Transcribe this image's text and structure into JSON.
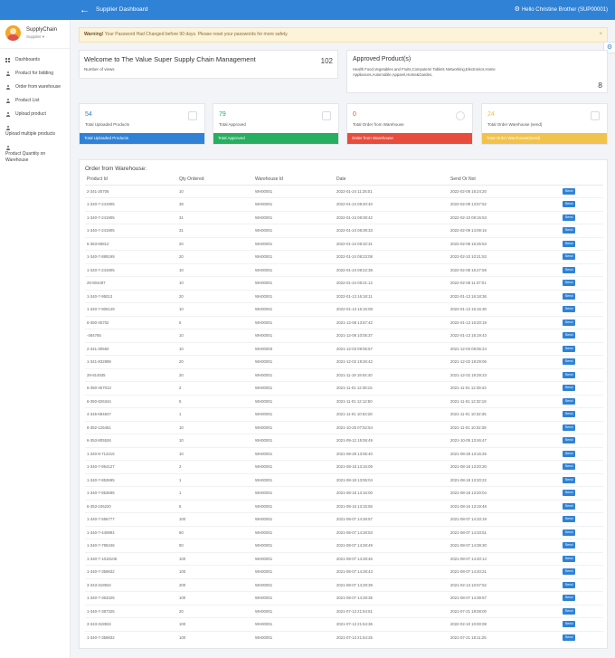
{
  "topbar": {
    "title": "Supplier Dashboard",
    "back_icon": "arrow-left-icon",
    "greeting": "Hello Christine Brother (SUP00001)"
  },
  "sidebar": {
    "brand_name": "SupplyChain",
    "role": "Supplier ▾",
    "items": [
      {
        "label": "Dashboards",
        "icon": "grid-icon"
      },
      {
        "label": "Product for bidding",
        "icon": "user-icon"
      },
      {
        "label": "Order from warehouse",
        "icon": "user-icon"
      },
      {
        "label": "Product List",
        "icon": "user-icon"
      },
      {
        "label": "Upload product",
        "icon": "user-icon"
      },
      {
        "label": "Upload multiple products",
        "icon": "user-icon"
      },
      {
        "label": "Product Quantity on Warehouse",
        "icon": "user-icon"
      }
    ]
  },
  "alert": {
    "strong": "Warning!",
    "text": " Your Password Had Changed before 90 days. Please reset your passwords for more safety.",
    "close": "×"
  },
  "welcome": {
    "title": "Welcome to The Value Super Supply Chain Management",
    "count": "102",
    "sub": "Number of views"
  },
  "approved": {
    "title": "Approved Product(s)",
    "list": "Health Food,Vegetables and Fruits,Computers/ Tablets Networking,Electronics,Home Appliances,Automobile,Apparel,Home&Garden,",
    "count": "8"
  },
  "stats": [
    {
      "value": "54",
      "label": "Total Uploaded Products",
      "footer": "Total Uploaded Products",
      "color": "#2f82d6"
    },
    {
      "value": "79",
      "label": "Total Approved",
      "footer": "Total Approved",
      "color": "#27ae60"
    },
    {
      "value": "0",
      "label": "Total Order from Warehouse",
      "footer": "Order from Warehouse",
      "color": "#e74c3c"
    },
    {
      "value": "24",
      "label": "Total Order Warehouse (send)",
      "footer": "Total Order Warehouse(send)",
      "color": "#f1c24c"
    }
  ],
  "orders": {
    "title": "Order from Warehouse:",
    "columns": [
      "Product Id",
      "Qty Ordered",
      "Warehouse Id",
      "Date",
      "Send Or Not"
    ],
    "send_label": "Send",
    "rows": [
      [
        "2-341-25706",
        "10",
        "WH00001",
        "2022-01-24 11:25:01",
        "2022-02-08 16:24:20"
      ],
      [
        "1-340-7-241905",
        "39",
        "WH00001",
        "2022-01-24 08:40:40",
        "2022-02-09 13:57:52"
      ],
      [
        "1-340-7-241905",
        "31",
        "WH00001",
        "2022-01-24 08:39:42",
        "2022-02-10 09:15:53"
      ],
      [
        "1-340-7-241905",
        "31",
        "WH00001",
        "2022-01-24 08:39:33",
        "2022-02-09 14:09:16"
      ],
      [
        "6-353-69812",
        "20",
        "WH00001",
        "2022-01-24 08:32:31",
        "2022-02-08 16:25:53"
      ],
      [
        "1-340-7-889199",
        "20",
        "WH00001",
        "2022-01-24 08:23:08",
        "2022-02-10 10:21:53"
      ],
      [
        "1-340-7-241905",
        "10",
        "WH00001",
        "2022-01-24 08:22:38",
        "2022-02-08 16:27:59"
      ],
      [
        "29-804497",
        "10",
        "WH00001",
        "2022-01-24 08:21:12",
        "2022-02-08 11:37:01"
      ],
      [
        "1-340-7-95013",
        "20",
        "WH00001",
        "2022-01-13 16:18:11",
        "2022-01-13 16:18:36"
      ],
      [
        "1-340-7-906149",
        "10",
        "WH00001",
        "2022-01-13 16:16:08",
        "2022-01-13 16:16:30"
      ],
      [
        "6-350-45702",
        "5",
        "WH00001",
        "2021-12-08 13:57:42",
        "2022-01-13 16:20:19"
      ],
      [
        "-484765",
        "10",
        "WH00001",
        "2021-12-08 10:05:37",
        "2022-01-13 16:19:43"
      ],
      [
        "2-341-30550",
        "10",
        "WH00003",
        "2021-12-03 09:05:57",
        "2021-12-03 09:06:24"
      ],
      [
        "1-341-832899",
        "20",
        "WH00001",
        "2021-12-02 19:26:42",
        "2021-12-02 19:29:06"
      ],
      [
        "29-914935",
        "20",
        "WH00001",
        "2021-11-19 19:04:40",
        "2021-12-02 19:29:23"
      ],
      [
        "6-350-457013",
        "2",
        "WH00001",
        "2021-11-01 12:39:15",
        "2021-11-01 12:39:43"
      ],
      [
        "6-350-826344",
        "5",
        "WH00001",
        "2021-11-01 12:12:50",
        "2021-11-01 12:32:18"
      ],
      [
        "4-345-684847",
        "1",
        "WH00001",
        "2021-11-01 10:53:28",
        "2021-11-01 10:32:35"
      ],
      [
        "6-352-125451",
        "10",
        "WH00001",
        "2021-10-25 07:52:54",
        "2021-11-01 10:32:38"
      ],
      [
        "6-353-805526",
        "10",
        "WH00001",
        "2021-09-12 15:06:49",
        "2021-10-05 13:46:47"
      ],
      [
        "1-340-8-712216",
        "10",
        "WH00001",
        "2021-08-28 13:06:40",
        "2021-08-28 13:16:26"
      ],
      [
        "1-340-7-854127",
        "2",
        "WH00001",
        "2021-08-18 13:16:09",
        "2021-08-18 13:20:30"
      ],
      [
        "1-340-7-853695",
        "1",
        "WH00001",
        "2021-08-18 13:06:04",
        "2021-08-18 13:20:22"
      ],
      [
        "1-340-7-853695",
        "1",
        "WH00001",
        "2021-08-18 13:16:00",
        "2021-08-18 13:20:04"
      ],
      [
        "6-353-106220",
        "5",
        "WH00001",
        "2021-08-16 13:15:56",
        "2021-08-16 13:19:48"
      ],
      [
        "1-340-7-556777",
        "100",
        "WH00001",
        "2021-08-07 14:28:57",
        "2021-08-07 14:33:19"
      ],
      [
        "1-340-7-440894",
        "50",
        "WH00001",
        "2021-08-07 14:28:53",
        "2021-08-07 14:33:51"
      ],
      [
        "1-340-7-795346",
        "50",
        "WH00001",
        "2021-08-07 14:28:49",
        "2021-08-07 14:39:30"
      ],
      [
        "1-340-7-1018108",
        "100",
        "WH00001",
        "2021-08-07 14:28:46",
        "2021-08-07 14:40:14"
      ],
      [
        "1-340-7-359832",
        "100",
        "WH00001",
        "2021-08-07 14:28:43",
        "2021-08-07 14:40:21"
      ],
      [
        "3-343-318934",
        "200",
        "WH00001",
        "2021-08-07 14:28:39",
        "2021-02-13 10:57:52"
      ],
      [
        "1-340-7-363325",
        "100",
        "WH00001",
        "2021-08-07 14:28:35",
        "2021-08-07 14:39:57"
      ],
      [
        "1-340-7-387325",
        "20",
        "WH00001",
        "2021-07-13 21:54:51",
        "2021-07-21 18:08:00"
      ],
      [
        "3-343-318934",
        "100",
        "WH00001",
        "2021-07-13 21:54:36",
        "2022-02-10 10:00:08"
      ],
      [
        "1-340-7-359832",
        "100",
        "WH00001",
        "2021-07-13 21:54:25",
        "2021-07-21 18:11:25"
      ]
    ]
  }
}
